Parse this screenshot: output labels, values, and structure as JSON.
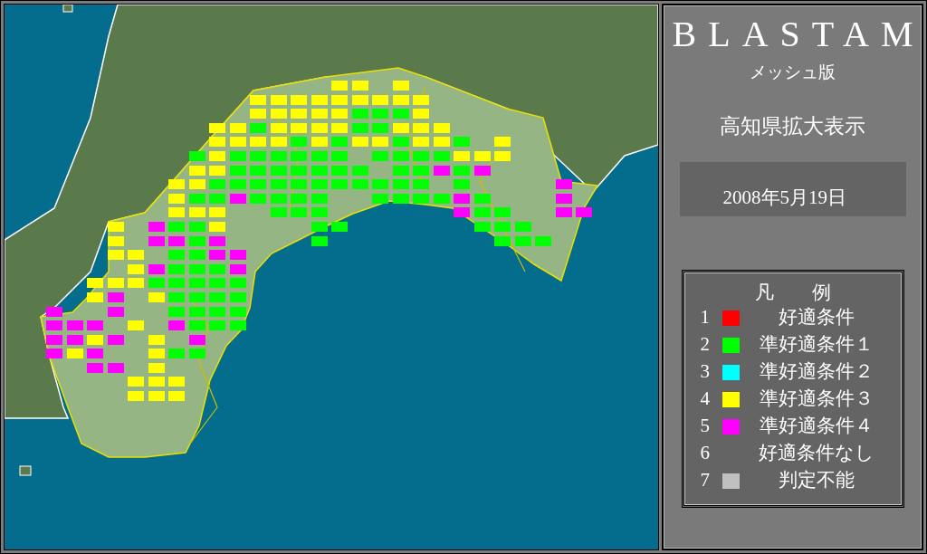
{
  "panel": {
    "title": "BLASTAM",
    "subtitle": "メッシュ版",
    "region": "高知県拡大表示",
    "date": "2008年5月19日"
  },
  "legend": {
    "title": "凡　　例",
    "items": [
      {
        "number": "1",
        "label": "好適条件",
        "color": "#ff0000"
      },
      {
        "number": "2",
        "label": "準好適条件１",
        "color": "#00ff00"
      },
      {
        "number": "3",
        "label": "準好適条件２",
        "color": "#00ffff"
      },
      {
        "number": "4",
        "label": "準好適条件３",
        "color": "#ffff00"
      },
      {
        "number": "5",
        "label": "準好適条件４",
        "color": "#ff00ff"
      },
      {
        "number": "6",
        "label": "好適条件なし"
      },
      {
        "number": "7",
        "label": "判定不能",
        "color": "#c0c0c0"
      }
    ]
  },
  "mesh": {
    "rows": [
      {
        "cells": [
          {
            "kind": "blank"
          },
          {
            "kind": "blank"
          },
          {
            "kind": "blank"
          },
          {
            "kind": "blank"
          },
          {
            "kind": "blank"
          },
          {
            "kind": "blank"
          },
          {
            "kind": "blank"
          },
          {
            "kind": "blank"
          },
          {
            "kind": "blank"
          },
          {
            "kind": "blank"
          },
          {
            "kind": "blank"
          },
          {
            "kind": "blank"
          },
          {
            "kind": "blank"
          },
          {
            "kind": "blank"
          },
          {
            "kind": "mesh",
            "color": "#ffff00"
          },
          {
            "kind": "mesh",
            "color": "#ffff00"
          },
          {
            "kind": "blank"
          },
          {
            "kind": "mesh",
            "color": "#ffff00"
          }
        ]
      },
      {
        "cells": [
          {
            "kind": "blank"
          },
          {
            "kind": "blank"
          },
          {
            "kind": "blank"
          },
          {
            "kind": "blank"
          },
          {
            "kind": "blank"
          },
          {
            "kind": "blank"
          },
          {
            "kind": "blank"
          },
          {
            "kind": "blank"
          },
          {
            "kind": "blank"
          },
          {
            "kind": "blank"
          },
          {
            "kind": "mesh",
            "color": "#ffff00"
          },
          {
            "kind": "mesh",
            "color": "#ffff00"
          },
          {
            "kind": "mesh",
            "color": "#ffff00"
          },
          {
            "kind": "mesh",
            "color": "#ffff00"
          },
          {
            "kind": "mesh",
            "color": "#ffff00"
          },
          {
            "kind": "mesh",
            "color": "#ffff00"
          },
          {
            "kind": "mesh",
            "color": "#ffff00"
          },
          {
            "kind": "mesh",
            "color": "#ffff00"
          },
          {
            "kind": "mesh",
            "color": "#ffff00"
          }
        ]
      },
      {
        "cells": [
          {
            "kind": "blank"
          },
          {
            "kind": "blank"
          },
          {
            "kind": "blank"
          },
          {
            "kind": "blank"
          },
          {
            "kind": "blank"
          },
          {
            "kind": "blank"
          },
          {
            "kind": "blank"
          },
          {
            "kind": "blank"
          },
          {
            "kind": "blank"
          },
          {
            "kind": "blank"
          },
          {
            "kind": "mesh",
            "color": "#ffff00"
          },
          {
            "kind": "mesh",
            "color": "#ffff00"
          },
          {
            "kind": "mesh",
            "color": "#ffff00"
          },
          {
            "kind": "mesh",
            "color": "#ffff00"
          },
          {
            "kind": "mesh",
            "color": "#ffff00"
          },
          {
            "kind": "mesh",
            "color": "#00ff00"
          },
          {
            "kind": "mesh",
            "color": "#00ff00"
          },
          {
            "kind": "mesh",
            "color": "#00ff00"
          },
          {
            "kind": "mesh",
            "color": "#ffff00"
          }
        ]
      },
      {
        "cells": [
          {
            "kind": "blank"
          },
          {
            "kind": "blank"
          },
          {
            "kind": "blank"
          },
          {
            "kind": "blank"
          },
          {
            "kind": "blank"
          },
          {
            "kind": "blank"
          },
          {
            "kind": "blank"
          },
          {
            "kind": "blank"
          },
          {
            "kind": "mesh",
            "color": "#ffff00"
          },
          {
            "kind": "mesh",
            "color": "#ffff00"
          },
          {
            "kind": "mesh",
            "color": "#00ff00"
          },
          {
            "kind": "mesh",
            "color": "#ffff00"
          },
          {
            "kind": "mesh",
            "color": "#ffff00"
          },
          {
            "kind": "mesh",
            "color": "#ffff00"
          },
          {
            "kind": "mesh",
            "color": "#ffff00"
          },
          {
            "kind": "mesh",
            "color": "#00ff00"
          },
          {
            "kind": "mesh",
            "color": "#00ff00"
          },
          {
            "kind": "mesh",
            "color": "#ffff00"
          },
          {
            "kind": "mesh",
            "color": "#ffff00"
          },
          {
            "kind": "mesh",
            "color": "#ffff00"
          }
        ]
      },
      {
        "cells": [
          {
            "kind": "blank"
          },
          {
            "kind": "blank"
          },
          {
            "kind": "blank"
          },
          {
            "kind": "blank"
          },
          {
            "kind": "blank"
          },
          {
            "kind": "blank"
          },
          {
            "kind": "blank"
          },
          {
            "kind": "blank"
          },
          {
            "kind": "mesh",
            "color": "#ffff00"
          },
          {
            "kind": "mesh",
            "color": "#ffff00"
          },
          {
            "kind": "mesh",
            "color": "#ffff00"
          },
          {
            "kind": "mesh",
            "color": "#ffff00"
          },
          {
            "kind": "mesh",
            "color": "#00ff00"
          },
          {
            "kind": "mesh",
            "color": "#ffff00"
          },
          {
            "kind": "mesh",
            "color": "#00ff00"
          },
          {
            "kind": "mesh",
            "color": "#ffff00"
          },
          {
            "kind": "mesh",
            "color": "#ffff00"
          },
          {
            "kind": "mesh",
            "color": "#00ff00"
          },
          {
            "kind": "mesh",
            "color": "#ffff00"
          },
          {
            "kind": "mesh",
            "color": "#ffff00"
          },
          {
            "kind": "mesh",
            "color": "#00ff00"
          },
          {
            "kind": "blank"
          },
          {
            "kind": "mesh",
            "color": "#ffff00"
          }
        ]
      },
      {
        "cells": [
          {
            "kind": "blank"
          },
          {
            "kind": "blank"
          },
          {
            "kind": "blank"
          },
          {
            "kind": "blank"
          },
          {
            "kind": "blank"
          },
          {
            "kind": "blank"
          },
          {
            "kind": "blank"
          },
          {
            "kind": "mesh",
            "color": "#00ff00"
          },
          {
            "kind": "mesh",
            "color": "#ffff00"
          },
          {
            "kind": "mesh",
            "color": "#00ff00"
          },
          {
            "kind": "mesh",
            "color": "#00ff00"
          },
          {
            "kind": "mesh",
            "color": "#00ff00"
          },
          {
            "kind": "mesh",
            "color": "#00ff00"
          },
          {
            "kind": "mesh",
            "color": "#00ff00"
          },
          {
            "kind": "mesh",
            "color": "#00ff00"
          },
          {
            "kind": "blank"
          },
          {
            "kind": "mesh",
            "color": "#00ff00"
          },
          {
            "kind": "mesh",
            "color": "#00ff00"
          },
          {
            "kind": "mesh",
            "color": "#00ff00"
          },
          {
            "kind": "mesh",
            "color": "#00ff00"
          },
          {
            "kind": "mesh",
            "color": "#ffff00"
          },
          {
            "kind": "mesh",
            "color": "#ffff00"
          },
          {
            "kind": "mesh",
            "color": "#ffff00"
          }
        ]
      },
      {
        "cells": [
          {
            "kind": "blank"
          },
          {
            "kind": "blank"
          },
          {
            "kind": "blank"
          },
          {
            "kind": "blank"
          },
          {
            "kind": "blank"
          },
          {
            "kind": "blank"
          },
          {
            "kind": "blank"
          },
          {
            "kind": "mesh",
            "color": "#ffff00"
          },
          {
            "kind": "mesh",
            "color": "#ffff00"
          },
          {
            "kind": "mesh",
            "color": "#00ff00"
          },
          {
            "kind": "mesh",
            "color": "#00ff00"
          },
          {
            "kind": "mesh",
            "color": "#00ff00"
          },
          {
            "kind": "mesh",
            "color": "#00ff00"
          },
          {
            "kind": "mesh",
            "color": "#00ff00"
          },
          {
            "kind": "mesh",
            "color": "#00ff00"
          },
          {
            "kind": "mesh",
            "color": "#00ff00"
          },
          {
            "kind": "blank"
          },
          {
            "kind": "mesh",
            "color": "#00ff00"
          },
          {
            "kind": "mesh",
            "color": "#00ff00"
          },
          {
            "kind": "mesh",
            "color": "#ff00ff"
          },
          {
            "kind": "mesh",
            "color": "#00ff00"
          },
          {
            "kind": "mesh",
            "color": "#ff00ff"
          }
        ]
      },
      {
        "cells": [
          {
            "kind": "blank"
          },
          {
            "kind": "blank"
          },
          {
            "kind": "blank"
          },
          {
            "kind": "blank"
          },
          {
            "kind": "blank"
          },
          {
            "kind": "blank"
          },
          {
            "kind": "mesh",
            "color": "#ffff00"
          },
          {
            "kind": "mesh",
            "color": "#ffff00"
          },
          {
            "kind": "mesh",
            "color": "#00ff00"
          },
          {
            "kind": "mesh",
            "color": "#00ff00"
          },
          {
            "kind": "mesh",
            "color": "#00ff00"
          },
          {
            "kind": "mesh",
            "color": "#00ff00"
          },
          {
            "kind": "mesh",
            "color": "#00ff00"
          },
          {
            "kind": "mesh",
            "color": "#00ff00"
          },
          {
            "kind": "mesh",
            "color": "#00ff00"
          },
          {
            "kind": "mesh",
            "color": "#00ff00"
          },
          {
            "kind": "mesh",
            "color": "#00ff00"
          },
          {
            "kind": "mesh",
            "color": "#00ff00"
          },
          {
            "kind": "mesh",
            "color": "#00ff00"
          },
          {
            "kind": "blank"
          },
          {
            "kind": "mesh",
            "color": "#00ff00"
          },
          {
            "kind": "blank"
          },
          {
            "kind": "blank"
          },
          {
            "kind": "blank"
          },
          {
            "kind": "blank"
          },
          {
            "kind": "mesh",
            "color": "#ff00ff"
          }
        ]
      },
      {
        "cells": [
          {
            "kind": "blank"
          },
          {
            "kind": "blank"
          },
          {
            "kind": "blank"
          },
          {
            "kind": "blank"
          },
          {
            "kind": "blank"
          },
          {
            "kind": "blank"
          },
          {
            "kind": "mesh",
            "color": "#ffff00"
          },
          {
            "kind": "mesh",
            "color": "#00ff00"
          },
          {
            "kind": "mesh",
            "color": "#00ff00"
          },
          {
            "kind": "mesh",
            "color": "#ff00ff"
          },
          {
            "kind": "mesh",
            "color": "#00ff00"
          },
          {
            "kind": "mesh",
            "color": "#00ff00"
          },
          {
            "kind": "mesh",
            "color": "#00ff00"
          },
          {
            "kind": "mesh",
            "color": "#00ff00"
          },
          {
            "kind": "blank"
          },
          {
            "kind": "blank"
          },
          {
            "kind": "mesh",
            "color": "#00ff00"
          },
          {
            "kind": "mesh",
            "color": "#00ff00"
          },
          {
            "kind": "mesh",
            "color": "#00ff00"
          },
          {
            "kind": "mesh",
            "color": "#00ff00"
          },
          {
            "kind": "mesh",
            "color": "#ff00ff"
          },
          {
            "kind": "mesh",
            "color": "#00ff00"
          },
          {
            "kind": "blank"
          },
          {
            "kind": "blank"
          },
          {
            "kind": "blank"
          },
          {
            "kind": "mesh",
            "color": "#ff00ff"
          }
        ]
      },
      {
        "cells": [
          {
            "kind": "blank"
          },
          {
            "kind": "blank"
          },
          {
            "kind": "blank"
          },
          {
            "kind": "blank"
          },
          {
            "kind": "blank"
          },
          {
            "kind": "blank"
          },
          {
            "kind": "mesh",
            "color": "#ffff00"
          },
          {
            "kind": "mesh",
            "color": "#ffff00"
          },
          {
            "kind": "mesh",
            "color": "#ffff00"
          },
          {
            "kind": "blank"
          },
          {
            "kind": "blank"
          },
          {
            "kind": "mesh",
            "color": "#00ff00"
          },
          {
            "kind": "mesh",
            "color": "#00ff00"
          },
          {
            "kind": "mesh",
            "color": "#00ff00"
          },
          {
            "kind": "blank"
          },
          {
            "kind": "blank"
          },
          {
            "kind": "blank"
          },
          {
            "kind": "blank"
          },
          {
            "kind": "blank"
          },
          {
            "kind": "blank"
          },
          {
            "kind": "mesh",
            "color": "#ff00ff"
          },
          {
            "kind": "mesh",
            "color": "#00ff00"
          },
          {
            "kind": "mesh",
            "color": "#00ff00"
          },
          {
            "kind": "blank"
          },
          {
            "kind": "blank"
          },
          {
            "kind": "mesh",
            "color": "#ff00ff"
          },
          {
            "kind": "mesh",
            "color": "#ff00ff"
          }
        ]
      },
      {
        "cells": [
          {
            "kind": "blank"
          },
          {
            "kind": "blank"
          },
          {
            "kind": "blank"
          },
          {
            "kind": "mesh",
            "color": "#ffff00"
          },
          {
            "kind": "blank"
          },
          {
            "kind": "mesh",
            "color": "#ff00ff"
          },
          {
            "kind": "mesh",
            "color": "#00ff00"
          },
          {
            "kind": "mesh",
            "color": "#00ff00"
          },
          {
            "kind": "mesh",
            "color": "#ffff00"
          },
          {
            "kind": "blank"
          },
          {
            "kind": "blank"
          },
          {
            "kind": "blank"
          },
          {
            "kind": "blank"
          },
          {
            "kind": "mesh",
            "color": "#00ff00"
          },
          {
            "kind": "mesh",
            "color": "#00ff00"
          },
          {
            "kind": "blank"
          },
          {
            "kind": "blank"
          },
          {
            "kind": "blank"
          },
          {
            "kind": "blank"
          },
          {
            "kind": "blank"
          },
          {
            "kind": "blank"
          },
          {
            "kind": "mesh",
            "color": "#00ff00"
          },
          {
            "kind": "mesh",
            "color": "#00ff00"
          },
          {
            "kind": "mesh",
            "color": "#00ff00"
          }
        ]
      },
      {
        "cells": [
          {
            "kind": "blank"
          },
          {
            "kind": "blank"
          },
          {
            "kind": "blank"
          },
          {
            "kind": "mesh",
            "color": "#ffff00"
          },
          {
            "kind": "blank"
          },
          {
            "kind": "mesh",
            "color": "#ff00ff"
          },
          {
            "kind": "mesh",
            "color": "#ff00ff"
          },
          {
            "kind": "mesh",
            "color": "#00ff00"
          },
          {
            "kind": "mesh",
            "color": "#ff00ff"
          },
          {
            "kind": "blank"
          },
          {
            "kind": "blank"
          },
          {
            "kind": "blank"
          },
          {
            "kind": "blank"
          },
          {
            "kind": "mesh",
            "color": "#00ff00"
          },
          {
            "kind": "blank"
          },
          {
            "kind": "blank"
          },
          {
            "kind": "blank"
          },
          {
            "kind": "blank"
          },
          {
            "kind": "blank"
          },
          {
            "kind": "blank"
          },
          {
            "kind": "blank"
          },
          {
            "kind": "blank"
          },
          {
            "kind": "mesh",
            "color": "#00ff00"
          },
          {
            "kind": "mesh",
            "color": "#00ff00"
          },
          {
            "kind": "mesh",
            "color": "#00ff00"
          }
        ]
      },
      {
        "cells": [
          {
            "kind": "blank"
          },
          {
            "kind": "blank"
          },
          {
            "kind": "blank"
          },
          {
            "kind": "mesh",
            "color": "#ffff00"
          },
          {
            "kind": "mesh",
            "color": "#ffff00"
          },
          {
            "kind": "blank"
          },
          {
            "kind": "mesh",
            "color": "#00ff00"
          },
          {
            "kind": "mesh",
            "color": "#00ff00"
          },
          {
            "kind": "mesh",
            "color": "#ff00ff"
          },
          {
            "kind": "mesh",
            "color": "#ff00ff"
          }
        ]
      },
      {
        "cells": [
          {
            "kind": "blank"
          },
          {
            "kind": "blank"
          },
          {
            "kind": "blank"
          },
          {
            "kind": "blank"
          },
          {
            "kind": "mesh",
            "color": "#ffff00"
          },
          {
            "kind": "mesh",
            "color": "#ff00ff"
          },
          {
            "kind": "mesh",
            "color": "#00ff00"
          },
          {
            "kind": "mesh",
            "color": "#00ff00"
          },
          {
            "kind": "mesh",
            "color": "#00ff00"
          },
          {
            "kind": "mesh",
            "color": "#ff00ff"
          }
        ]
      },
      {
        "cells": [
          {
            "kind": "blank"
          },
          {
            "kind": "blank"
          },
          {
            "kind": "mesh",
            "color": "#ffff00"
          },
          {
            "kind": "mesh",
            "color": "#ffff00"
          },
          {
            "kind": "mesh",
            "color": "#ffff00"
          },
          {
            "kind": "mesh",
            "color": "#00ff00"
          },
          {
            "kind": "mesh",
            "color": "#00ff00"
          },
          {
            "kind": "mesh",
            "color": "#00ff00"
          },
          {
            "kind": "mesh",
            "color": "#00ff00"
          },
          {
            "kind": "mesh",
            "color": "#00ff00"
          }
        ]
      },
      {
        "cells": [
          {
            "kind": "blank"
          },
          {
            "kind": "blank"
          },
          {
            "kind": "mesh",
            "color": "#ffff00"
          },
          {
            "kind": "mesh",
            "color": "#ff00ff"
          },
          {
            "kind": "blank"
          },
          {
            "kind": "mesh",
            "color": "#ffff00"
          },
          {
            "kind": "mesh",
            "color": "#00ff00"
          },
          {
            "kind": "mesh",
            "color": "#00ff00"
          },
          {
            "kind": "mesh",
            "color": "#00ff00"
          },
          {
            "kind": "mesh",
            "color": "#00ff00"
          }
        ]
      },
      {
        "cells": [
          {
            "kind": "mesh",
            "color": "#ff00ff"
          },
          {
            "kind": "blank"
          },
          {
            "kind": "blank"
          },
          {
            "kind": "mesh",
            "color": "#ff00ff"
          },
          {
            "kind": "blank"
          },
          {
            "kind": "blank"
          },
          {
            "kind": "mesh",
            "color": "#00ff00"
          },
          {
            "kind": "mesh",
            "color": "#00ff00"
          },
          {
            "kind": "mesh",
            "color": "#00ff00"
          },
          {
            "kind": "mesh",
            "color": "#00ff00"
          }
        ]
      },
      {
        "cells": [
          {
            "kind": "mesh",
            "color": "#ff00ff"
          },
          {
            "kind": "mesh",
            "color": "#ff00ff"
          },
          {
            "kind": "mesh",
            "color": "#ff00ff"
          },
          {
            "kind": "blank"
          },
          {
            "kind": "mesh",
            "color": "#ffff00"
          },
          {
            "kind": "blank"
          },
          {
            "kind": "mesh",
            "color": "#ff00ff"
          },
          {
            "kind": "mesh",
            "color": "#00ff00"
          },
          {
            "kind": "mesh",
            "color": "#00ff00"
          },
          {
            "kind": "mesh",
            "color": "#00ff00"
          }
        ]
      },
      {
        "cells": [
          {
            "kind": "mesh",
            "color": "#ff00ff"
          },
          {
            "kind": "mesh",
            "color": "#ff00ff"
          },
          {
            "kind": "mesh",
            "color": "#ffff00"
          },
          {
            "kind": "mesh",
            "color": "#ff00ff"
          },
          {
            "kind": "blank"
          },
          {
            "kind": "mesh",
            "color": "#ffff00"
          },
          {
            "kind": "blank"
          },
          {
            "kind": "mesh",
            "color": "#ff00ff"
          }
        ]
      },
      {
        "cells": [
          {
            "kind": "mesh",
            "color": "#ff00ff"
          },
          {
            "kind": "mesh",
            "color": "#ffff00"
          },
          {
            "kind": "mesh",
            "color": "#ff00ff"
          },
          {
            "kind": "blank"
          },
          {
            "kind": "blank"
          },
          {
            "kind": "mesh",
            "color": "#ffff00"
          },
          {
            "kind": "mesh",
            "color": "#00ff00"
          },
          {
            "kind": "mesh",
            "color": "#00ff00"
          }
        ]
      },
      {
        "cells": [
          {
            "kind": "blank"
          },
          {
            "kind": "blank"
          },
          {
            "kind": "mesh",
            "color": "#ff00ff"
          },
          {
            "kind": "mesh",
            "color": "#ff00ff"
          },
          {
            "kind": "blank"
          },
          {
            "kind": "mesh",
            "color": "#ffff00"
          }
        ]
      },
      {
        "cells": [
          {
            "kind": "blank"
          },
          {
            "kind": "blank"
          },
          {
            "kind": "blank"
          },
          {
            "kind": "blank"
          },
          {
            "kind": "mesh",
            "color": "#ffff00"
          },
          {
            "kind": "mesh",
            "color": "#ffff00"
          },
          {
            "kind": "mesh",
            "color": "#ffff00"
          }
        ]
      },
      {
        "cells": [
          {
            "kind": "blank"
          },
          {
            "kind": "blank"
          },
          {
            "kind": "blank"
          },
          {
            "kind": "blank"
          },
          {
            "kind": "mesh",
            "color": "#ffff00"
          },
          {
            "kind": "mesh",
            "color": "#ffff00"
          },
          {
            "kind": "mesh",
            "color": "#ffff00"
          }
        ]
      }
    ]
  }
}
